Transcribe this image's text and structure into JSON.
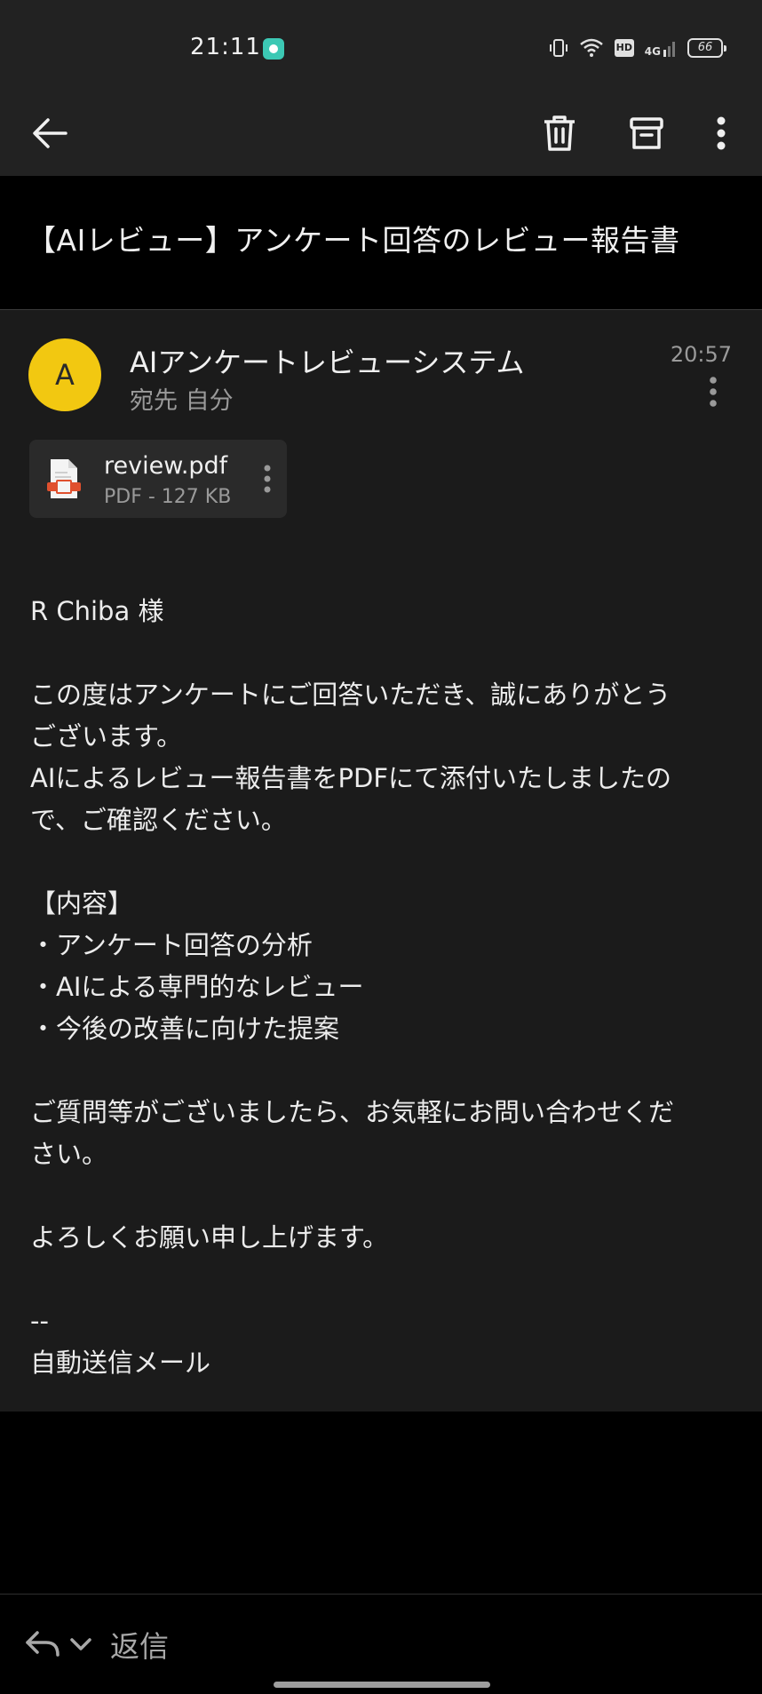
{
  "status_bar": {
    "time": "21:11",
    "hd": "HD",
    "network": "4G",
    "battery": "66"
  },
  "toolbar": {
    "back_icon": "arrow-left-icon",
    "delete_icon": "trash-icon",
    "archive_icon": "archive-icon",
    "more_icon": "more-vertical-icon"
  },
  "email": {
    "subject": "【AIレビュー】アンケート回答のレビュー報告書",
    "avatar_letter": "A",
    "avatar_color": "#f2c811",
    "sender": "AIアンケートレビューシステム",
    "recipient": "宛先 自分",
    "time": "20:57",
    "attachment": {
      "name": "review.pdf",
      "meta": "PDF - 127 KB"
    },
    "body": "R Chiba 様\n\nこの度はアンケートにご回答いただき、誠にありがとう\nございます。\nAIによるレビュー報告書をPDFにて添付いたしましたの\nで、ご確認ください。\n\n【内容】\n・アンケート回答の分析\n・AIによる専門的なレビュー\n・今後の改善に向けた提案\n\nご質問等がございましたら、お気軽にお問い合わせくだ\nさい。\n\nよろしくお願い申し上げます。\n\n--\n自動送信メール"
  },
  "reply_bar": {
    "label": "返信"
  }
}
